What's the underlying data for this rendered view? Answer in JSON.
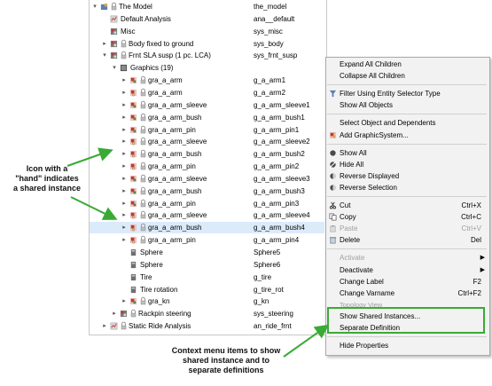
{
  "tree": {
    "rows": [
      {
        "label": "The Model",
        "value": "the_model",
        "icon": "model-icon",
        "expander": "▾",
        "lock": true
      },
      {
        "label": "Default Analysis",
        "value": "ana__default",
        "icon": "analysis-icon",
        "expander": "",
        "lock": false
      },
      {
        "label": "Misc",
        "value": "sys_misc",
        "icon": "system-icon",
        "expander": "",
        "lock": false
      },
      {
        "label": "Body fixed to ground",
        "value": "sys_body",
        "icon": "system-icon",
        "expander": "▸",
        "lock": true
      },
      {
        "label": "Frnt SLA susp (1 pc. LCA)",
        "value": "sys_frnt_susp",
        "icon": "system-icon",
        "expander": "▾",
        "lock": true
      },
      {
        "label": "Graphics (19)",
        "value": "",
        "icon": "folder-icon",
        "expander": "▾",
        "lock": false
      },
      {
        "label": "gra_a_arm",
        "value": "g_a_arm1",
        "icon": "graphic-icon",
        "expander": "▸",
        "lock": true
      },
      {
        "label": "gra_a_arm",
        "value": "g_a_arm2",
        "icon": "shared-graphic-icon",
        "expander": "▸",
        "lock": true
      },
      {
        "label": "gra_a_arm_sleeve",
        "value": "g_a_arm_sleeve1",
        "icon": "graphic-icon",
        "expander": "▸",
        "lock": true
      },
      {
        "label": "gra_a_arm_bush",
        "value": "g_a_arm_bush1",
        "icon": "graphic-icon",
        "expander": "▸",
        "lock": true
      },
      {
        "label": "gra_a_arm_pin",
        "value": "g_a_arm_pin1",
        "icon": "graphic-icon",
        "expander": "▸",
        "lock": true
      },
      {
        "label": "gra_a_arm_sleeve",
        "value": "g_a_arm_sleeve2",
        "icon": "shared-graphic-icon",
        "expander": "▸",
        "lock": true
      },
      {
        "label": "gra_a_arm_bush",
        "value": "g_a_arm_bush2",
        "icon": "shared-graphic-icon",
        "expander": "▸",
        "lock": true
      },
      {
        "label": "gra_a_arm_pin",
        "value": "g_a_arm_pin2",
        "icon": "shared-graphic-icon",
        "expander": "▸",
        "lock": true
      },
      {
        "label": "gra_a_arm_sleeve",
        "value": "g_a_arm_sleeve3",
        "icon": "graphic-icon",
        "expander": "▸",
        "lock": true
      },
      {
        "label": "gra_a_arm_bush",
        "value": "g_a_arm_bush3",
        "icon": "graphic-icon",
        "expander": "▸",
        "lock": true
      },
      {
        "label": "gra_a_arm_pin",
        "value": "g_a_arm_pin3",
        "icon": "graphic-icon",
        "expander": "▸",
        "lock": true
      },
      {
        "label": "gra_a_arm_sleeve",
        "value": "g_a_arm_sleeve4",
        "icon": "shared-graphic-icon",
        "expander": "▸",
        "lock": true
      },
      {
        "label": "gra_a_arm_bush",
        "value": "g_a_arm_bush4",
        "icon": "shared-graphic-icon",
        "expander": "▸",
        "lock": true,
        "selected": true
      },
      {
        "label": "gra_a_arm_pin",
        "value": "g_a_arm_pin4",
        "icon": "shared-graphic-icon",
        "expander": "▸",
        "lock": true
      },
      {
        "label": "Sphere",
        "value": "Sphere5",
        "icon": "primitive-icon",
        "expander": "",
        "lock": false
      },
      {
        "label": "Sphere",
        "value": "Sphere6",
        "icon": "primitive-icon",
        "expander": "",
        "lock": false
      },
      {
        "label": "Tire",
        "value": "g_tire",
        "icon": "primitive-icon",
        "expander": "",
        "lock": false
      },
      {
        "label": "Tire rotation",
        "value": "g_tire_rot",
        "icon": "primitive-icon",
        "expander": "",
        "lock": false
      },
      {
        "label": "gra_kn",
        "value": "g_kn",
        "icon": "graphic-icon",
        "expander": "▸",
        "lock": true
      },
      {
        "label": "Rackpin steering",
        "value": "sys_steering",
        "icon": "system-icon",
        "expander": "▸",
        "lock": true
      },
      {
        "label": "Static Ride Analysis",
        "value": "an_ride_frnt",
        "icon": "analysis-icon",
        "expander": "▸",
        "lock": true
      }
    ]
  },
  "context_menu": {
    "items": [
      {
        "label": "Expand All Children",
        "shortcut": "",
        "icon": "",
        "disabled": false
      },
      {
        "label": "Collapse All Children",
        "shortcut": "",
        "icon": "",
        "disabled": false
      },
      {
        "sep": true
      },
      {
        "label": "Filter Using Entity Selector Type",
        "shortcut": "",
        "icon": "filter-icon",
        "disabled": false
      },
      {
        "label": "Show All Objects",
        "shortcut": "",
        "icon": "",
        "disabled": false
      },
      {
        "sep": true
      },
      {
        "label": "Select Object and Dependents",
        "shortcut": "",
        "icon": "",
        "disabled": false
      },
      {
        "label": "Add GraphicSystem...",
        "shortcut": "",
        "icon": "graphic-system-icon",
        "disabled": false
      },
      {
        "sep": true
      },
      {
        "label": "Show All",
        "shortcut": "",
        "icon": "show-icon",
        "disabled": false
      },
      {
        "label": "Hide All",
        "shortcut": "",
        "icon": "hide-icon",
        "disabled": false
      },
      {
        "label": "Reverse Displayed",
        "shortcut": "",
        "icon": "reverse-icon",
        "disabled": false
      },
      {
        "label": "Reverse Selection",
        "shortcut": "",
        "icon": "reverse-icon",
        "disabled": false
      },
      {
        "sep": true
      },
      {
        "label": "Cut",
        "shortcut": "Ctrl+X",
        "icon": "cut-icon",
        "disabled": false
      },
      {
        "label": "Copy",
        "shortcut": "Ctrl+C",
        "icon": "copy-icon",
        "disabled": false
      },
      {
        "label": "Paste",
        "shortcut": "Ctrl+V",
        "icon": "paste-icon",
        "disabled": true
      },
      {
        "label": "Delete",
        "shortcut": "Del",
        "icon": "delete-icon",
        "disabled": false
      },
      {
        "sep": true
      },
      {
        "label": "Activate",
        "shortcut": "",
        "icon": "",
        "disabled": true,
        "submenu": true
      },
      {
        "label": "Deactivate",
        "shortcut": "",
        "icon": "",
        "disabled": false,
        "submenu": true
      },
      {
        "label": "Change Label",
        "shortcut": "F2",
        "icon": "",
        "disabled": false
      },
      {
        "label": "Change Varname",
        "shortcut": "Ctrl+F2",
        "icon": "",
        "disabled": false
      },
      {
        "label": "Topology View",
        "shortcut": "",
        "icon": "",
        "disabled": true,
        "small": true
      },
      {
        "label": "Show Shared Instances...",
        "shortcut": "",
        "icon": "",
        "disabled": false
      },
      {
        "label": "Separate Definition",
        "shortcut": "",
        "icon": "",
        "disabled": false
      },
      {
        "sep": true
      },
      {
        "label": "Hide Properties",
        "shortcut": "",
        "icon": "",
        "disabled": false
      }
    ]
  },
  "annotations": {
    "left_note": [
      "Icon with a",
      "\"hand\" indicates",
      "a shared instance"
    ],
    "bottom_note": [
      "Context menu items to show",
      "shared instance and to",
      "separate definitions"
    ]
  },
  "colors": {
    "accent_green": "#3aaa35",
    "selection": "#dcebfa"
  }
}
